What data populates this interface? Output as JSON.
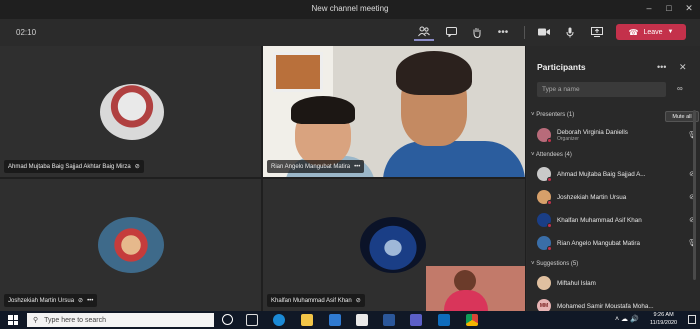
{
  "window": {
    "title": "New channel meeting"
  },
  "toolbar": {
    "timer": "02:10",
    "leave_label": "Leave"
  },
  "tiles": [
    {
      "name": "Ahmad Mujtaba Baig Sajjad Akhtar Baig Mirza"
    },
    {
      "name": "Rian Angelo Mangubat Matira"
    },
    {
      "name": "Joshzekiah Martin Ursua"
    },
    {
      "name": "Khalfan Muhammad Asif Khan"
    }
  ],
  "panel": {
    "title": "Participants",
    "search_placeholder": "Type a name",
    "presenters_label": "Presenters (1)",
    "mute_all_label": "Mute all",
    "presenters": [
      {
        "name": "Deborah Virginia Daniells",
        "role": "Organizer"
      }
    ],
    "attendees_label": "Attendees (4)",
    "attendees": [
      {
        "name": "Ahmad Mujtaba Baig Sajjad A..."
      },
      {
        "name": "Joshzekiah Martin Ursua"
      },
      {
        "name": "Khalfan Muhammad Asif Khan"
      },
      {
        "name": "Rian Angelo Mangubat Matira"
      }
    ],
    "suggestions_label": "Suggestions (5)",
    "suggestions": [
      {
        "name": "Miftahul Islam",
        "initials": ""
      },
      {
        "name": "Mohamed Samir Moustafa Moha...",
        "initials": "MM"
      }
    ]
  },
  "taskbar": {
    "search_placeholder": "Type here to search",
    "time": "9:26 AM",
    "date": "11/19/2020"
  },
  "colors": {
    "leave": "#c4314b",
    "accent": "#8b8cc7",
    "status_busy": "#c4314b"
  }
}
